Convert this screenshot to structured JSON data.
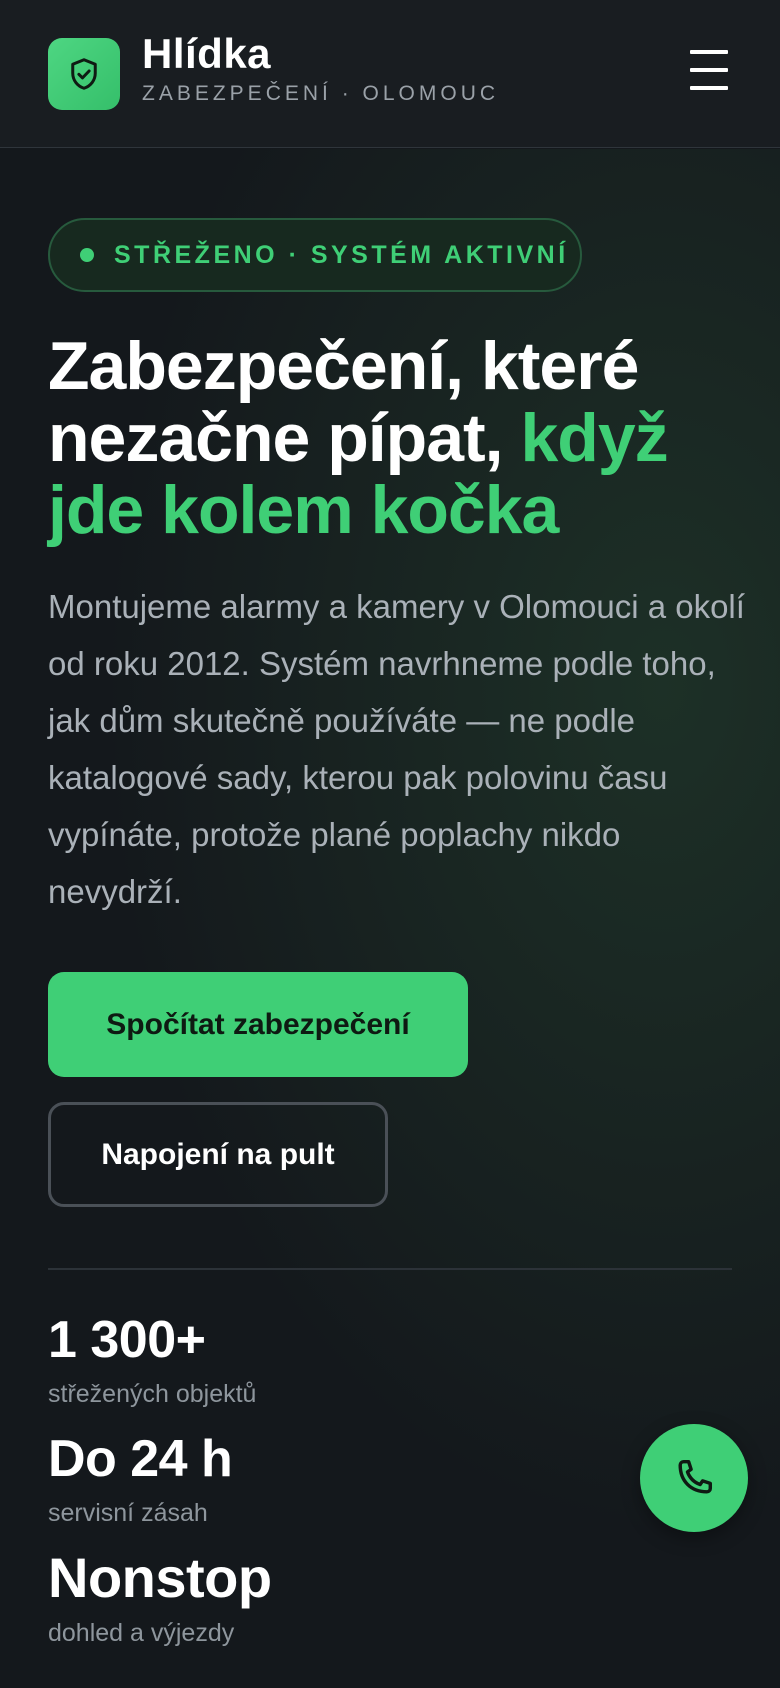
{
  "header": {
    "brand_name": "Hlídka",
    "brand_subtitle": "ZABEZPEČENÍ · OLOMOUC",
    "logo_icon": "shield-check-icon",
    "menu_icon": "hamburger-menu-icon"
  },
  "hero": {
    "status_text": "STŘEŽENO · SYSTÉM AKTIVNÍ",
    "headline_part1": "Zabezpečení, které nezačne pípat, ",
    "headline_accent": "když jde kolem kočka",
    "lead": "Montujeme alarmy a kamery v Olomouci a okolí od roku 2012. Systém navrhneme podle toho, jak dům skutečně používáte — ne podle katalogové sady, kterou pak polovinu času vypínáte, protože plané poplachy nikdo nevydrží.",
    "primary_button": "Spočítat zabezpečení",
    "secondary_button": "Napojení na pult"
  },
  "stats": [
    {
      "value": "1 300+",
      "label": "střežených objektů"
    },
    {
      "value": "Do 24 h",
      "label": "servisní zásah"
    },
    {
      "value": "Nonstop",
      "label": "dohled a výjezdy"
    }
  ],
  "fab": {
    "icon": "phone-icon"
  },
  "colors": {
    "accent": "#3fcf76",
    "background": "#14181c",
    "header_bg": "#191d21",
    "muted_text": "#aab1b8"
  }
}
